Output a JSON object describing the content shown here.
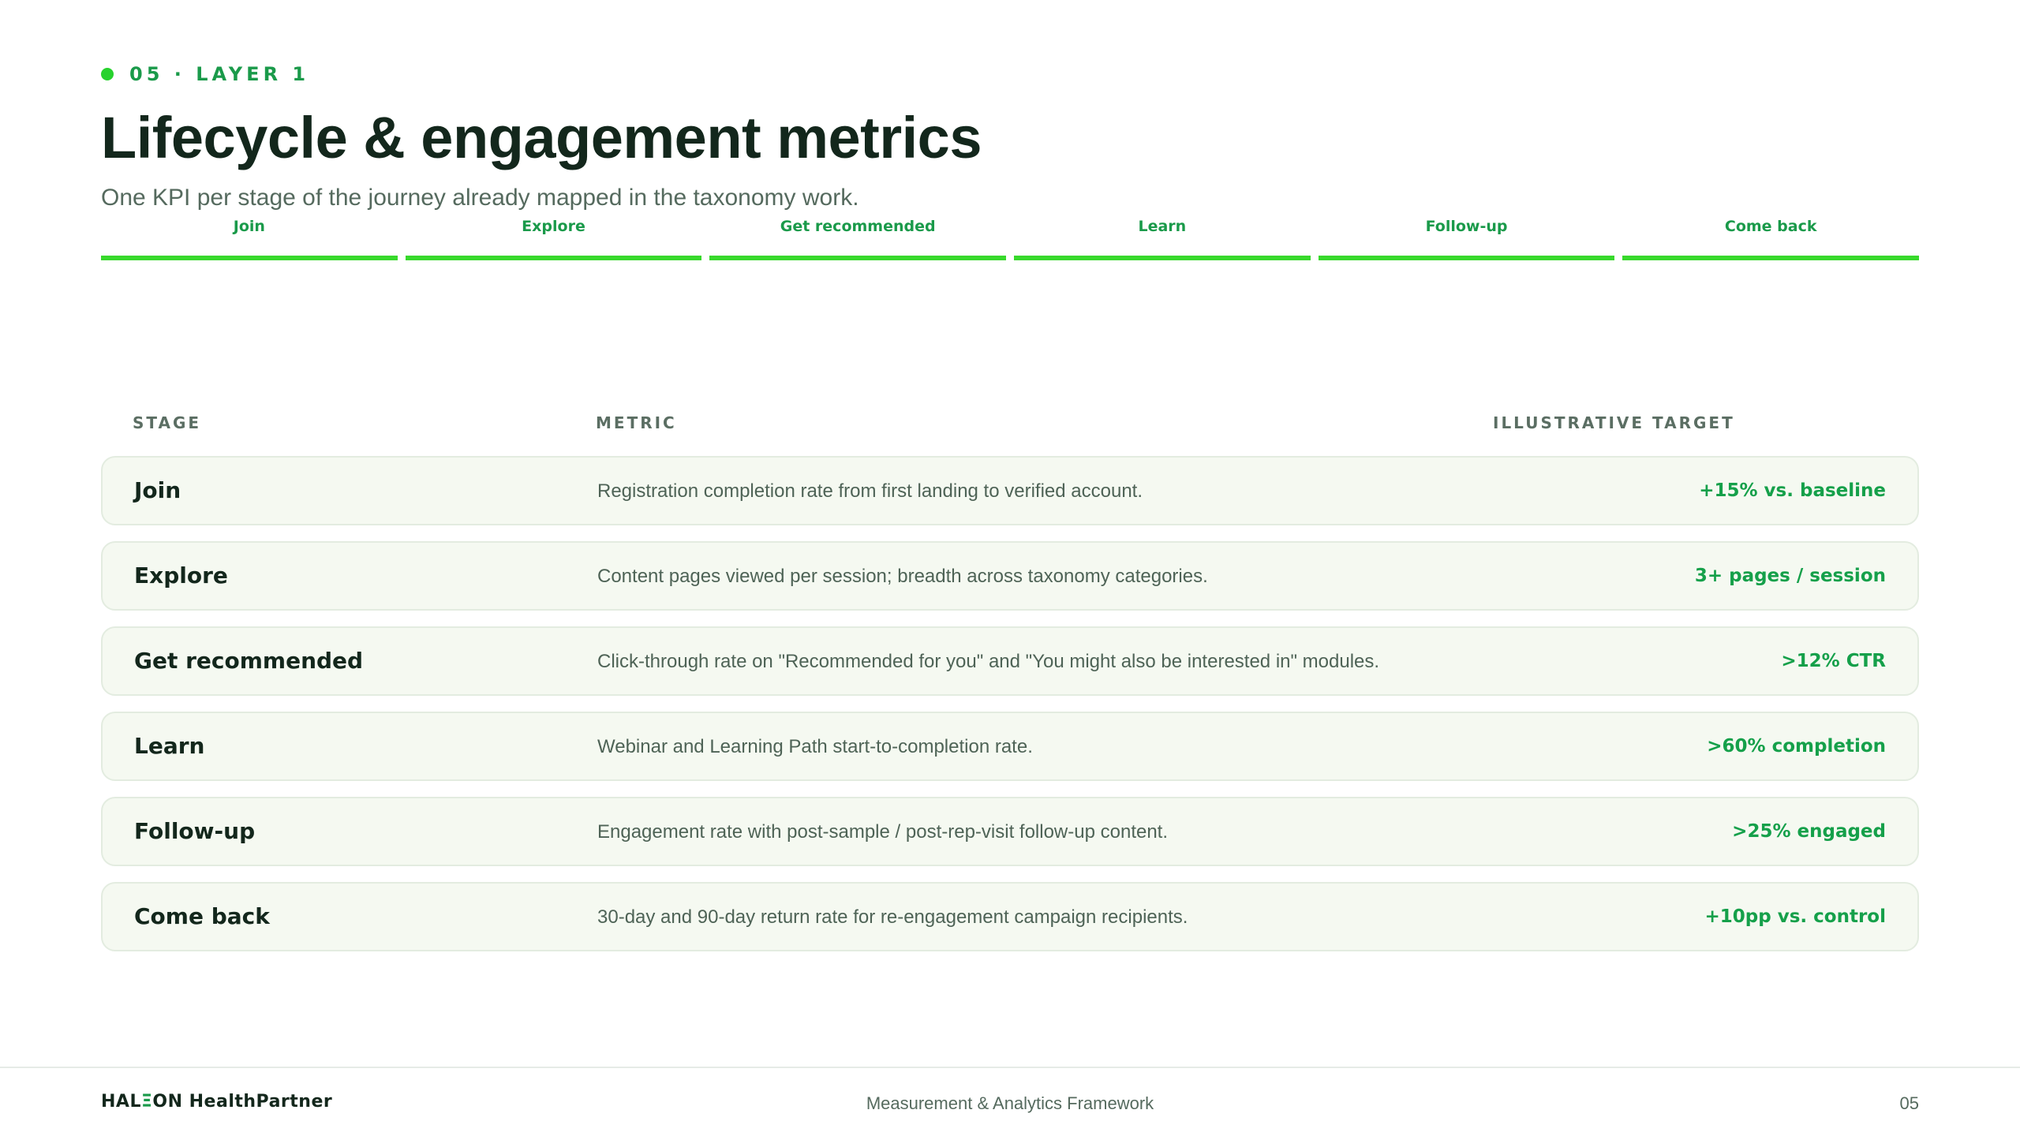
{
  "eyebrow": "05 · LAYER 1",
  "title": "Lifecycle & engagement metrics",
  "subtitle": "One KPI per stage of the journey already mapped in the taxonomy work.",
  "stages": [
    "Join",
    "Explore",
    "Get recommended",
    "Learn",
    "Follow-up",
    "Come back"
  ],
  "table": {
    "headers": {
      "stage": "STAGE",
      "metric": "METRIC",
      "target": "ILLUSTRATIVE TARGET"
    },
    "rows": [
      {
        "stage": "Join",
        "metric": "Registration completion rate from first landing to verified account.",
        "target": "+15% vs. baseline"
      },
      {
        "stage": "Explore",
        "metric": "Content pages viewed per session; breadth across taxonomy categories.",
        "target": "3+ pages / session"
      },
      {
        "stage": "Get recommended",
        "metric": "Click-through rate on \"Recommended for you\" and \"You might also be interested in\" modules.",
        "target": ">12% CTR"
      },
      {
        "stage": "Learn",
        "metric": "Webinar and Learning Path start-to-completion rate.",
        "target": ">60% completion"
      },
      {
        "stage": "Follow-up",
        "metric": "Engagement rate with post-sample / post-rep-visit follow-up content.",
        "target": ">25% engaged"
      },
      {
        "stage": "Come back",
        "metric": "30-day and 90-day return rate for re-engagement campaign recipients.",
        "target": "+10pp vs. control"
      }
    ]
  },
  "footer": {
    "brand_prefix": "HAL",
    "brand_mark": "Ξ",
    "brand_suffix": "ON HealthPartner",
    "center": "Measurement & Analytics Framework",
    "page": "05"
  },
  "colors": {
    "accent": "#38d92c",
    "accent_text": "#1a9a4a",
    "heading": "#13271c",
    "row_bg": "#f5f9f1"
  }
}
